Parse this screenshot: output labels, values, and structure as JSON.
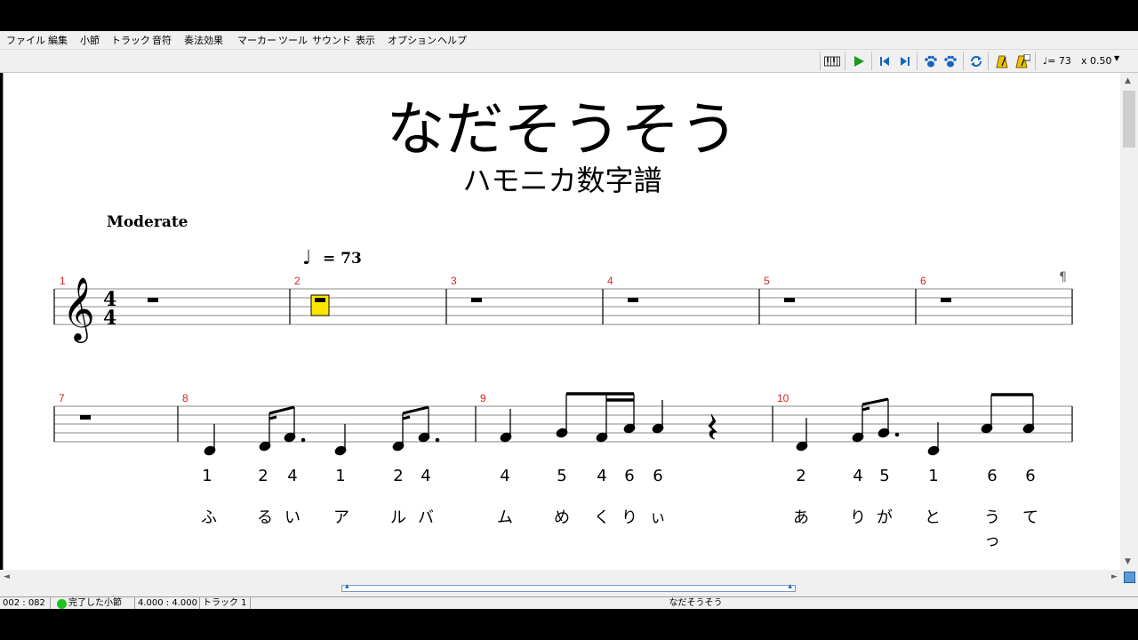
{
  "menu": [
    "ファイル",
    "編集",
    "小節",
    "トラック",
    "音符",
    "奏法効果",
    "マーカー",
    "ツール",
    "サウンド",
    "表示",
    "オプション",
    "ヘルプ"
  ],
  "toolbar": {
    "icons": [
      "keyboard-icon",
      "play-icon",
      "skip-back-icon",
      "skip-forward-icon",
      "paw-icon",
      "paw-icon",
      "loop-icon",
      "metronome-icon",
      "metronome-count-icon"
    ],
    "tempo_label": "♩= 73",
    "speed_label": "x 0.50"
  },
  "score": {
    "title": "なだそうそう",
    "subtitle": "ハモニカ数字譜",
    "tempo_text": "Moderate",
    "tempo_mark": "= 73",
    "pilcrow": "¶",
    "measure_numbers": [
      "1",
      "2",
      "3",
      "4",
      "5",
      "6",
      "7",
      "8",
      "9",
      "10"
    ],
    "digits": [
      "1",
      "2",
      "4",
      "1",
      "2",
      "4",
      "4",
      "5",
      "4",
      "6",
      "6",
      "2",
      "4",
      "5",
      "1",
      "6",
      "6"
    ],
    "lyrics": [
      "ふ",
      "る",
      "い",
      "ア",
      "ル",
      "バ",
      "ム",
      "め",
      "く",
      "り",
      "ぃ",
      "あ",
      "り",
      "が",
      "と",
      "うっ",
      "て"
    ]
  },
  "status": {
    "position": "002 : 082",
    "state": "完了した小節",
    "time": "4.000 : 4.000",
    "track": "トラック 1",
    "title": "なだそうそう"
  },
  "colors": {
    "measure_number": "#e02020",
    "highlight": "#ffe600",
    "play": "#1a9a1a",
    "accent": "#1565c0",
    "status_ok": "#22c022"
  }
}
